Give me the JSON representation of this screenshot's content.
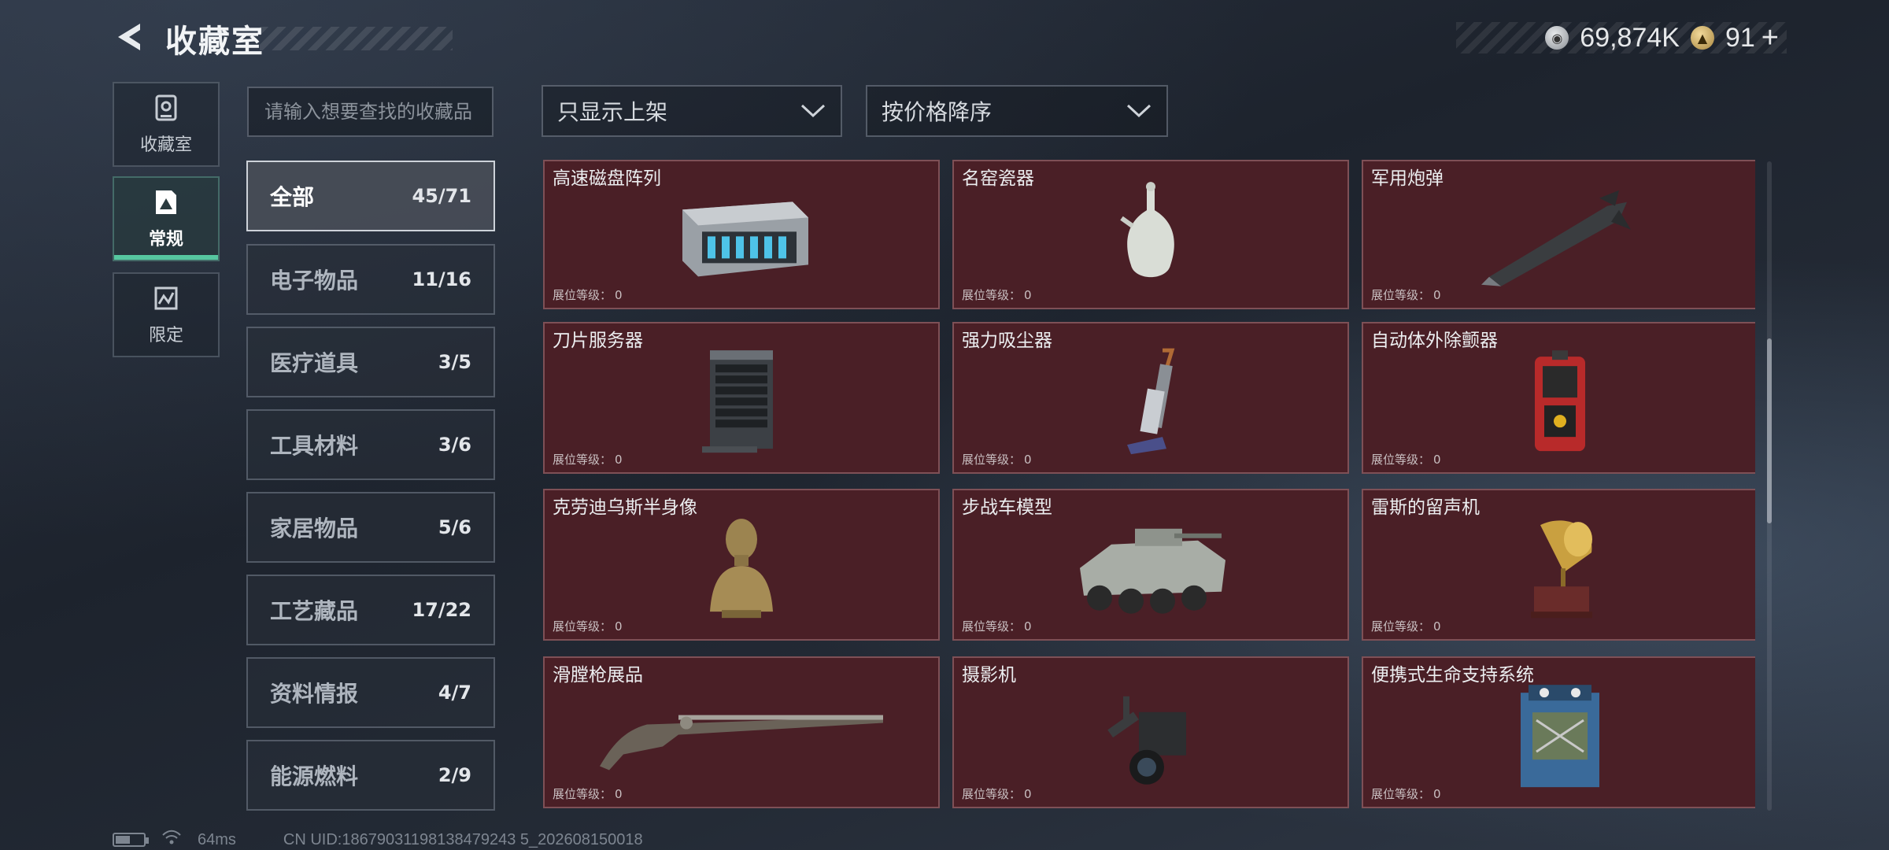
{
  "header": {
    "title": "收藏室",
    "currencies": [
      {
        "icon": "silver-coin-icon",
        "value": "69,874K"
      },
      {
        "icon": "gold-coin-icon",
        "value": "91",
        "suffix": "+"
      }
    ]
  },
  "side_nav": [
    {
      "label": "收藏室",
      "icon": "vault-icon",
      "active": false
    },
    {
      "label": "常规",
      "icon": "collection-icon",
      "active": true
    },
    {
      "label": "限定",
      "icon": "limited-icon",
      "active": false
    }
  ],
  "search": {
    "placeholder": "请输入想要查找的收藏品"
  },
  "filters": {
    "listing": "只显示上架",
    "sort": "按价格降序"
  },
  "categories": [
    {
      "name": "全部",
      "count": "45/71",
      "active": true
    },
    {
      "name": "电子物品",
      "count": "11/16"
    },
    {
      "name": "医疗道具",
      "count": "3/5"
    },
    {
      "name": "工具材料",
      "count": "3/6"
    },
    {
      "name": "家居物品",
      "count": "5/6"
    },
    {
      "name": "工艺藏品",
      "count": "17/22"
    },
    {
      "name": "资料情报",
      "count": "4/7"
    },
    {
      "name": "能源燃料",
      "count": "2/9"
    }
  ],
  "level_label": "展位等级：",
  "items": [
    {
      "name": "高速磁盘阵列",
      "level": "0",
      "icon": "disk-array-icon"
    },
    {
      "name": "名窑瓷器",
      "level": "0",
      "icon": "porcelain-vase-icon"
    },
    {
      "name": "军用炮弹",
      "level": "0",
      "icon": "artillery-shell-icon"
    },
    {
      "name": "刀片服务器",
      "level": "0",
      "icon": "blade-server-icon"
    },
    {
      "name": "强力吸尘器",
      "level": "0",
      "icon": "vacuum-cleaner-icon"
    },
    {
      "name": "自动体外除颤器",
      "level": "0",
      "icon": "defibrillator-icon"
    },
    {
      "name": "克劳迪乌斯半身像",
      "level": "0",
      "icon": "bust-statue-icon"
    },
    {
      "name": "步战车模型",
      "level": "0",
      "icon": "ifv-model-icon"
    },
    {
      "name": "雷斯的留声机",
      "level": "0",
      "icon": "gramophone-icon"
    },
    {
      "name": "滑膛枪展品",
      "level": "0",
      "icon": "musket-icon"
    },
    {
      "name": "摄影机",
      "level": "0",
      "icon": "video-camera-icon"
    },
    {
      "name": "便携式生命支持系统",
      "level": "0",
      "icon": "life-support-icon"
    }
  ],
  "footer": {
    "ping": "64ms",
    "uid": "CN UID:18679031198138479243 5_202608150018"
  }
}
